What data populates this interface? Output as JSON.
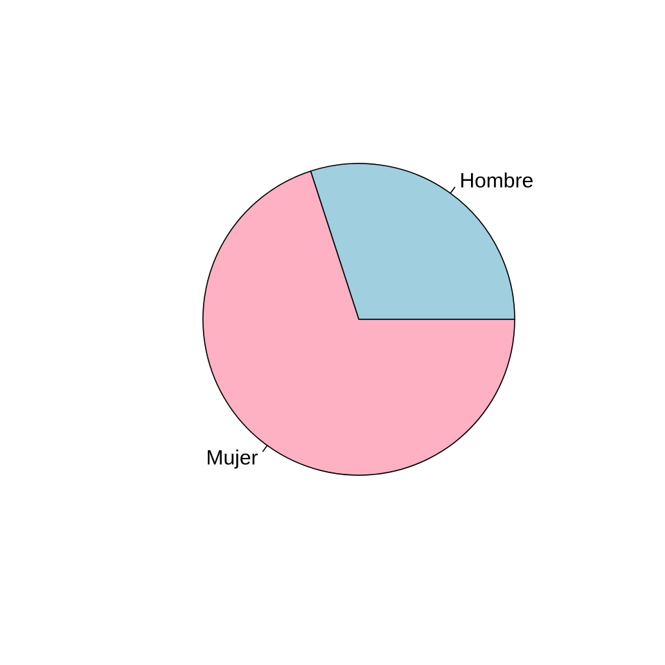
{
  "chart_data": {
    "type": "pie",
    "title": "",
    "direction": "counterclockwise",
    "start_angle_degrees": 0,
    "slices": [
      {
        "label": "Hombre",
        "value": 0.3,
        "color": "#A0CFE0"
      },
      {
        "label": "Mujer",
        "value": 0.7,
        "color": "#FDB1C2"
      }
    ]
  }
}
